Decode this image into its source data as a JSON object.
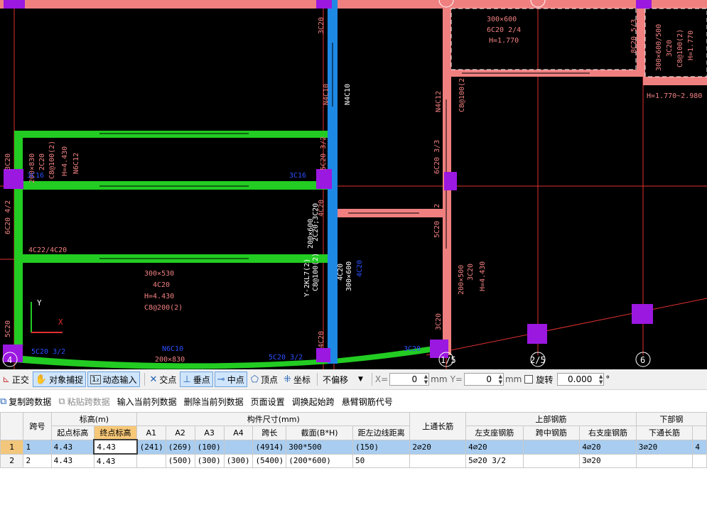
{
  "cad": {
    "labels": {
      "t1": "300×600",
      "t2": "6C20 2/4",
      "t3": "H=1.770",
      "t4": "8C20 5/3",
      "t5": "300×600/500",
      "t6": "3C20",
      "t7": "C8@100(2)",
      "t8": "H=1.770",
      "t9": "H=1.770~2.980",
      "t10": "3C20",
      "t11": "N4C10",
      "t12": "N4C10",
      "t13": "N4C12",
      "t14": "C8@100(2)",
      "t15": "6C20 3/3",
      "t16": "5C20 3/2",
      "t17": "3C20",
      "t18": "200×830",
      "t19": "2C20",
      "t20": "C8@100(2)",
      "t21": "H=4.430",
      "t22": "N6C12",
      "t23": "3C16",
      "t24": "3C16",
      "t25": "5C20 3/2",
      "t26": "6C20 4/2",
      "t27": "4C22/4C20",
      "t28": "300×530",
      "t29": "4C20",
      "t30": "H=4.430",
      "t31": "C8@200(2)",
      "t32": "200×600",
      "t33": "Y-2KL7(2)",
      "t34": "C8@100(2)",
      "t35": "2C20;3C20",
      "t36": "4C20",
      "t37": "4C20",
      "t38": "300×600",
      "t39": "4C20",
      "t40": "200×500",
      "t41": "3C20",
      "t42": "H=4.430",
      "t43": "3C20",
      "t44": "5C20",
      "t45": "N6C10",
      "t46": "200×830",
      "t47": "5C20 3/2",
      "t48": "5C20 3/2",
      "t49": "4C20",
      "t50": "3C20",
      "axis1": "1/5",
      "axis2": "2/5",
      "axis3": "6",
      "axis4": "4",
      "ucs_y": "Y",
      "ucs_x": "X"
    }
  },
  "snapbar": {
    "ortho": "正交",
    "object_snap": "对象捕捉",
    "dynamic_input": "动态输入",
    "intersection": "交点",
    "perpendicular": "垂点",
    "midpoint": "中点",
    "vertex": "顶点",
    "coordinate": "坐标",
    "offset_mode": "不偏移",
    "x_label": "X=",
    "x_value": "0",
    "y_label": "Y=",
    "y_value": "0",
    "unit1": "mm",
    "unit2": "mm",
    "rotate_label": "旋转",
    "rotate_value": "0.000",
    "degree": "°"
  },
  "actionbar": {
    "copy_span": "复制跨数据",
    "paste_span": "粘贴跨数据",
    "input_col": "输入当前列数据",
    "delete_col": "删除当前列数据",
    "page_setup": "页面设置",
    "swap_start": "调换起始跨",
    "cantilever": "悬臂钢筋代号"
  },
  "table": {
    "headers": {
      "span_no": "跨号",
      "elevation": "标高(m)",
      "start_elev": "起点标高",
      "end_elev": "终点标高",
      "dims": "构件尺寸(mm)",
      "a1": "A1",
      "a2": "A2",
      "a3": "A3",
      "a4": "A4",
      "span_len": "跨长",
      "section": "截面(B*H)",
      "dist_left": "距左边线距离",
      "top_through": "上通长筋",
      "top_rebar": "上部钢筋",
      "left_support": "左支座钢筋",
      "mid_span": "跨中钢筋",
      "right_support": "右支座钢筋",
      "bottom_rebar": "下部钢",
      "bottom_through": "下通长筋"
    },
    "rows": [
      {
        "idx": "1",
        "span": "1",
        "start": "4.43",
        "end": "4.43",
        "a1": "(241)",
        "a2": "(269)",
        "a3": "(100)",
        "a4": "",
        "len": "(4914)",
        "sec": "300*500",
        "dist": "(150)",
        "top": "2⌀20",
        "left": "4⌀20",
        "mid": "",
        "right": "4⌀20",
        "bot": "3⌀20",
        "extra": "4"
      },
      {
        "idx": "2",
        "span": "2",
        "start": "4.43",
        "end": "4.43",
        "a1": "",
        "a2": "(500)",
        "a3": "(300)",
        "a4": "(300)",
        "len": "(5400)",
        "sec": "(200*600)",
        "dist": "50",
        "top": "",
        "left": "5⌀20 3/2",
        "mid": "",
        "right": "3⌀20",
        "bot": "",
        "extra": ""
      }
    ]
  }
}
